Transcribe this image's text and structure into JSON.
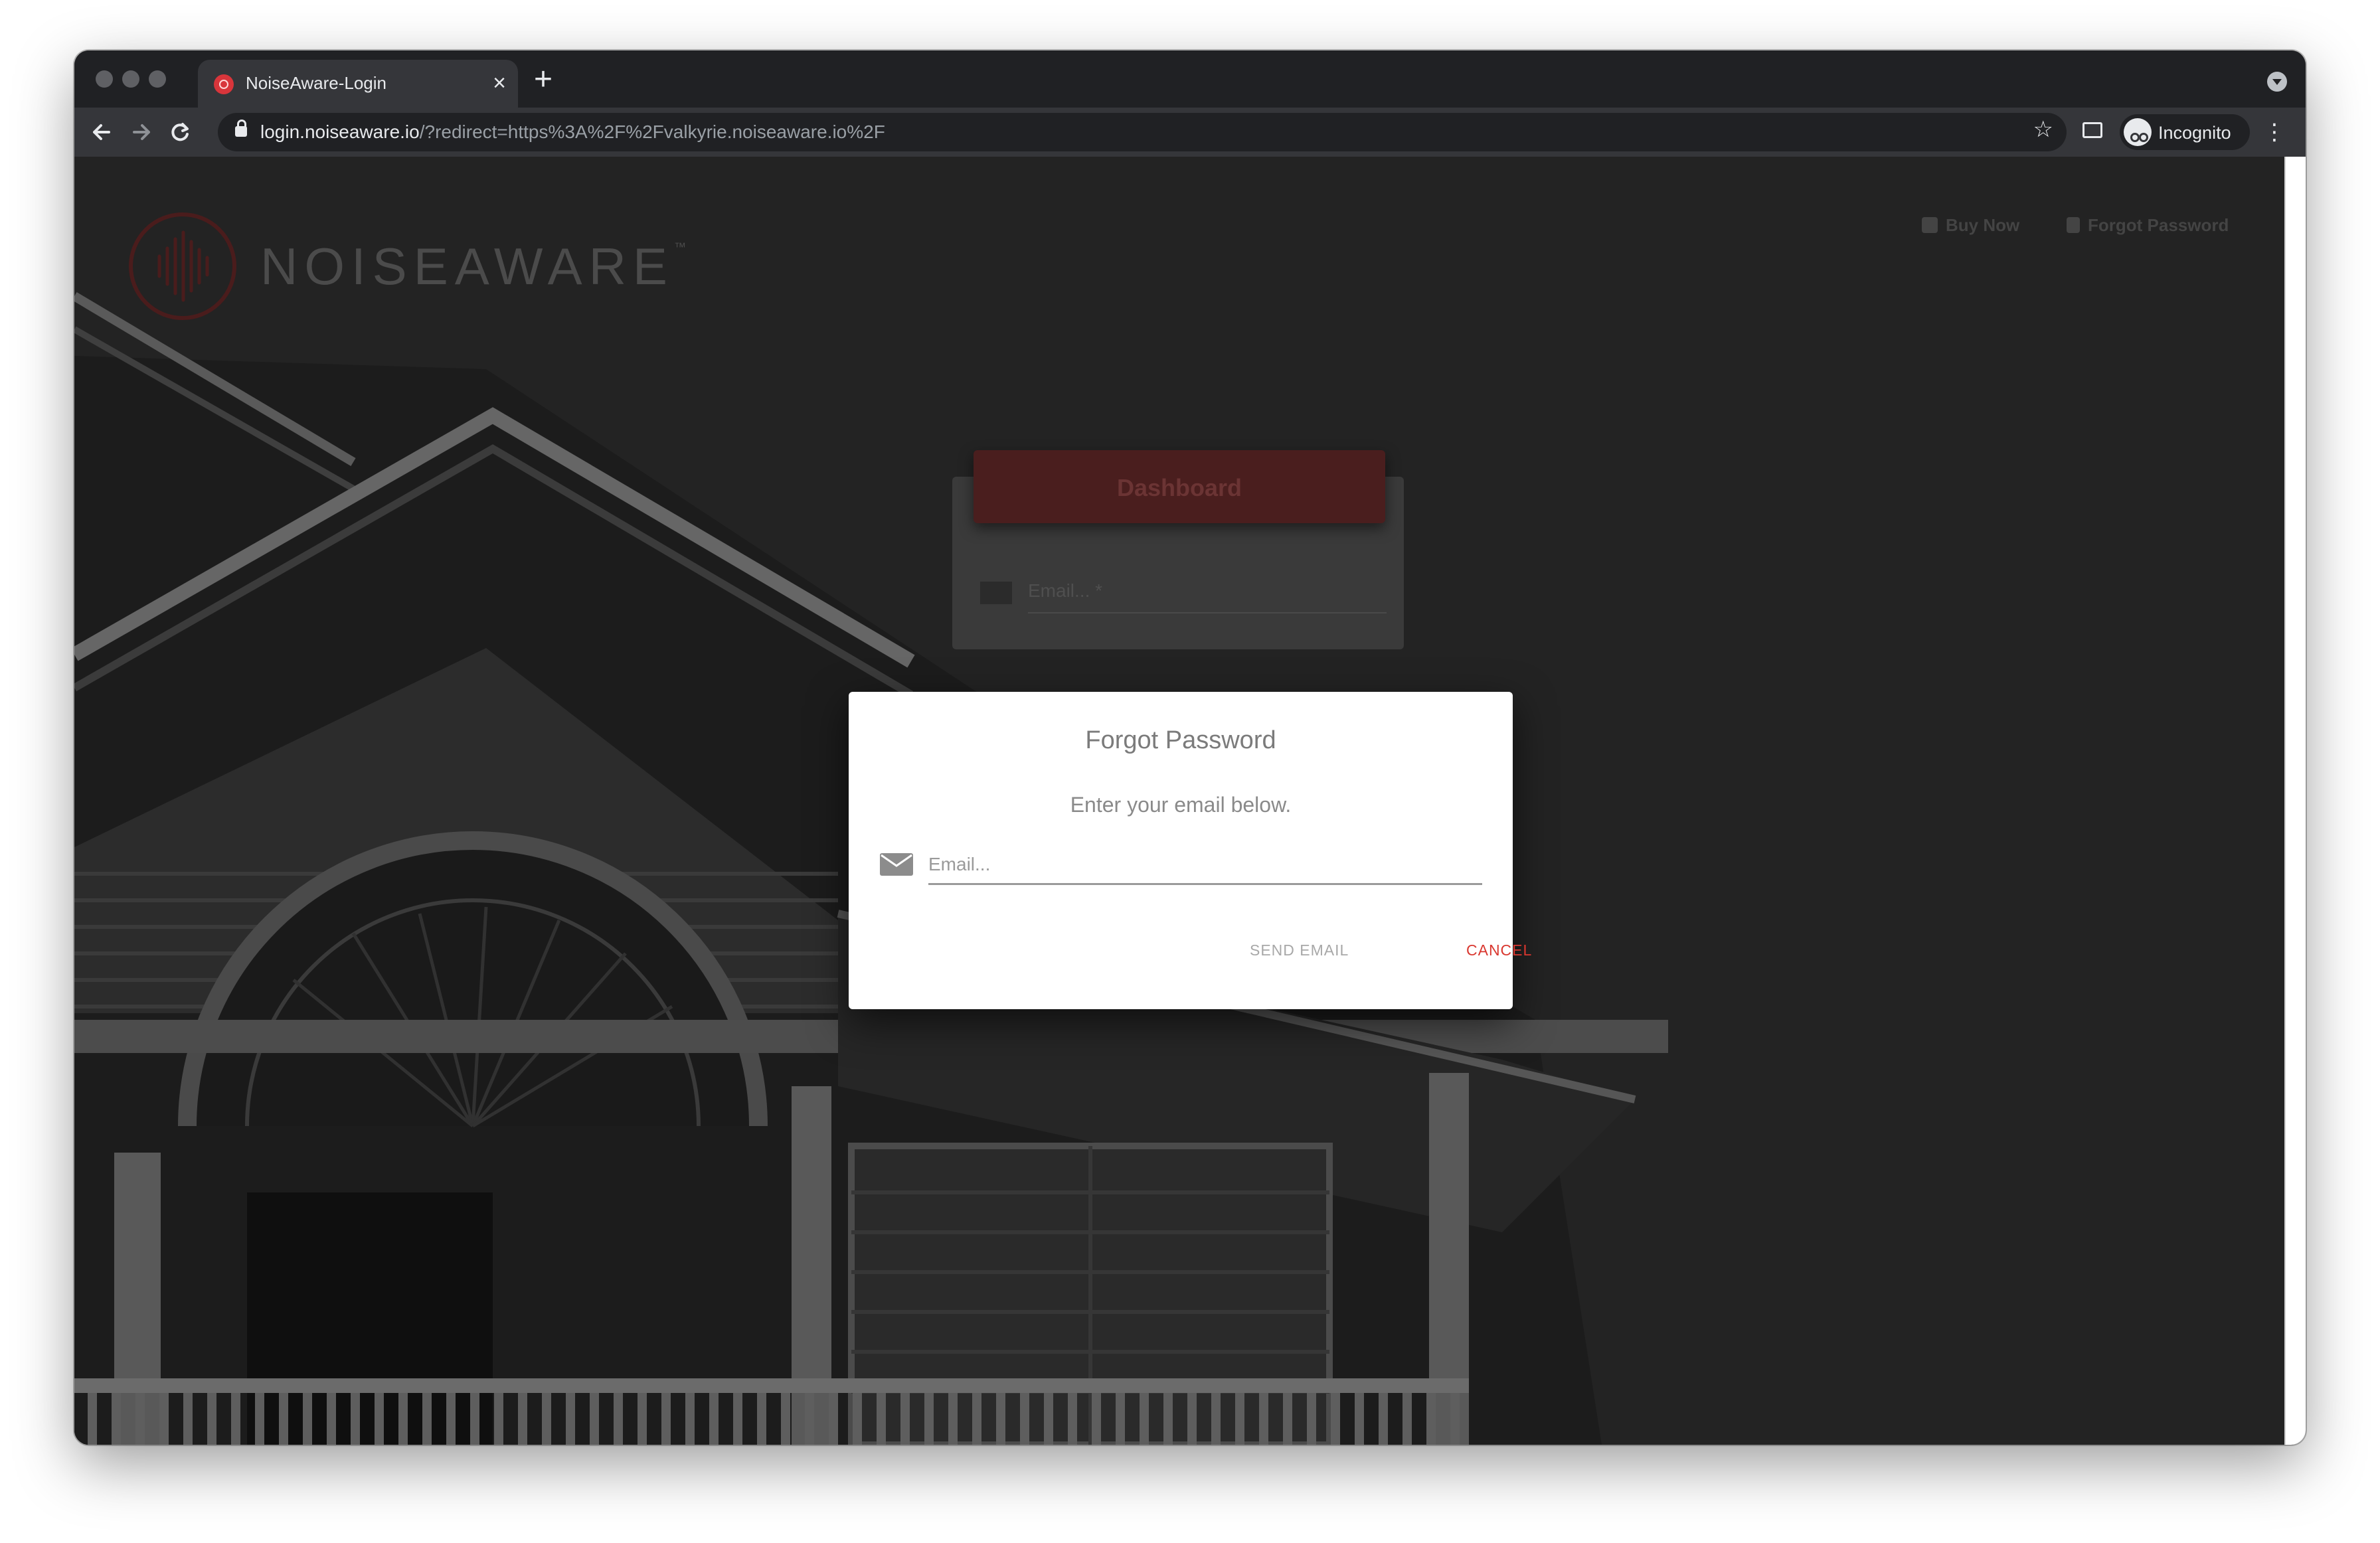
{
  "browser": {
    "tab_title": "NoiseAware-Login",
    "tab_close": "×",
    "new_tab": "+",
    "url_host": "login.noiseaware.io",
    "url_rest": "/?redirect=https%3A%2F%2Fvalkyrie.noiseaware.io%2F",
    "profile_label": "Incognito",
    "icons": [
      "back-arrow-icon",
      "forward-arrow-icon",
      "reload-icon",
      "lock-icon",
      "star-icon",
      "cast-icon",
      "incognito-icon",
      "kebab-menu-icon"
    ]
  },
  "page": {
    "brand": "NOISEAWARE",
    "trademark": "™",
    "nav": {
      "buy_now": "Buy Now",
      "forgot_password": "Forgot Password"
    },
    "login_card": {
      "button": "Dashboard",
      "email_placeholder": "Email... *"
    }
  },
  "modal": {
    "title": "Forgot Password",
    "subtitle": "Enter your email below.",
    "email_placeholder": "Email...",
    "send_label": "SEND EMAIL",
    "cancel_label": "CANCEL"
  },
  "colors": {
    "accent": "#d9372f",
    "chrome_dark": "#202124",
    "chrome_toolbar": "#35363a"
  }
}
